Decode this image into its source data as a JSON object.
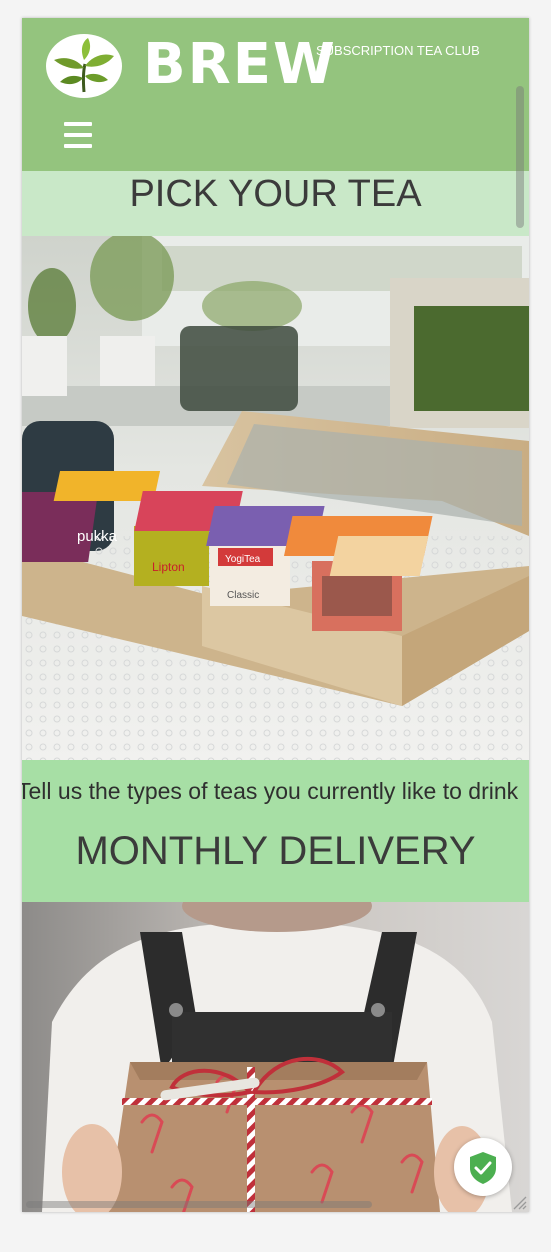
{
  "header": {
    "brand": "BREW",
    "tagline": "SUBSCRIPTION TEA CLUB",
    "logo_icon": "tea-leaves-icon",
    "menu_icon": "hamburger-menu-icon",
    "background_color": "#94c47e"
  },
  "sections": [
    {
      "title": "PICK YOUR TEA",
      "image": "wooden tea box with assorted tea bags",
      "description": "Tell us the types of teas you currently like to drink",
      "title_background": "#c9e8c8"
    },
    {
      "title": "MONTHLY DELIVERY",
      "image": "person holding a wrapped gift box",
      "title_background": "#a7dfa5"
    }
  ],
  "badge": {
    "icon": "shield-check-icon",
    "color": "#4caf50"
  }
}
